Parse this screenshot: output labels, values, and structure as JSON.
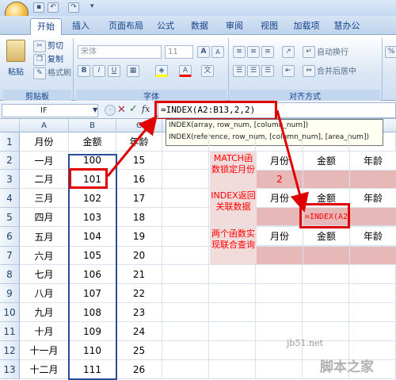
{
  "ribbon": {
    "tabs": [
      "开始",
      "插入",
      "页面布局",
      "公式",
      "数据",
      "审阅",
      "视图",
      "加载项",
      "慧办公"
    ],
    "clipboard": {
      "paste": "粘贴",
      "cut": "剪切",
      "copy": "复制",
      "format_painter": "格式刷",
      "group": "剪贴板"
    },
    "font": {
      "font_name": "宋体",
      "font_size": "11",
      "group": "字体",
      "bold": "B",
      "italic": "I",
      "underline": "U",
      "grow": "A",
      "shrink": "A"
    },
    "alignment": {
      "wrap": "自动换行",
      "merge": "合并后居中",
      "group": "对齐方式"
    }
  },
  "formula_bar": {
    "name_box": "IF",
    "fx": "fx",
    "formula": "=INDEX(A2:B13,2,2)"
  },
  "tooltip": {
    "line1": "INDEX(array, row_num, [column_num])",
    "line2": "INDEX(reference, row_num, [column_num], [area_num])"
  },
  "columns": [
    "A",
    "B",
    "C"
  ],
  "rows": [
    "1",
    "2",
    "3",
    "4",
    "5",
    "6",
    "7",
    "8",
    "9",
    "10",
    "11",
    "12",
    "13"
  ],
  "sheet": {
    "header": {
      "month": "月份",
      "amount": "金额",
      "age": "年龄"
    },
    "data": [
      {
        "month": "一月",
        "amount": "100",
        "age": "15"
      },
      {
        "month": "二月",
        "amount": "101",
        "age": "16"
      },
      {
        "month": "三月",
        "amount": "102",
        "age": "17"
      },
      {
        "month": "四月",
        "amount": "103",
        "age": "18"
      },
      {
        "month": "五月",
        "amount": "104",
        "age": "19"
      },
      {
        "month": "六月",
        "amount": "105",
        "age": "20"
      },
      {
        "month": "七月",
        "amount": "106",
        "age": "21"
      },
      {
        "month": "八月",
        "amount": "107",
        "age": "22"
      },
      {
        "month": "九月",
        "amount": "108",
        "age": "23"
      },
      {
        "month": "十月",
        "amount": "109",
        "age": "24"
      },
      {
        "month": "十一月",
        "amount": "110",
        "age": "25"
      },
      {
        "month": "十二月",
        "amount": "111",
        "age": "26"
      }
    ]
  },
  "side": {
    "b1_label": "MATCH函数锁定月份",
    "b1_h": [
      "月份",
      "金额",
      "年龄"
    ],
    "b1_val": "2",
    "b2_label": "INDEX返回关联数据",
    "b2_h": [
      "月份",
      "金额",
      "年龄"
    ],
    "b2_val": "=INDEX(A2",
    "b3_label": "两个函数实现联合查询",
    "b3_h": [
      "月份",
      "金额",
      "年龄"
    ]
  },
  "watermark": {
    "site": "jb51.net",
    "name": "脚本之家"
  }
}
